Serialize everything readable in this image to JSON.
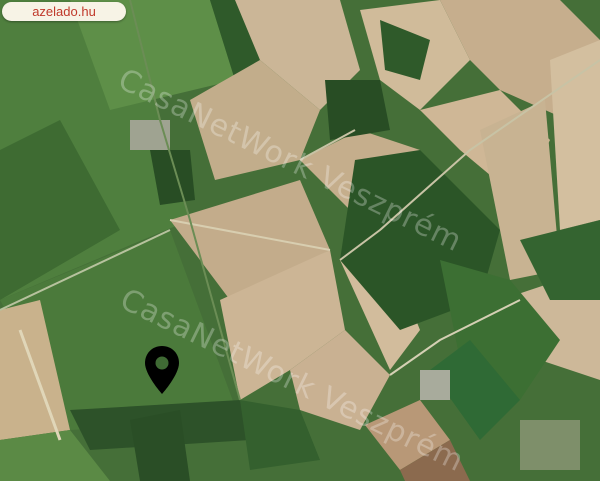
{
  "site": {
    "label": "azelado.hu"
  },
  "watermark": {
    "text": "CasaNetWork Veszprém"
  },
  "marker": {
    "icon": "map-pin-icon"
  },
  "colors": {
    "marker": "#000000",
    "badge_bg": "#f7f3e6",
    "badge_text": "#c0392b"
  }
}
